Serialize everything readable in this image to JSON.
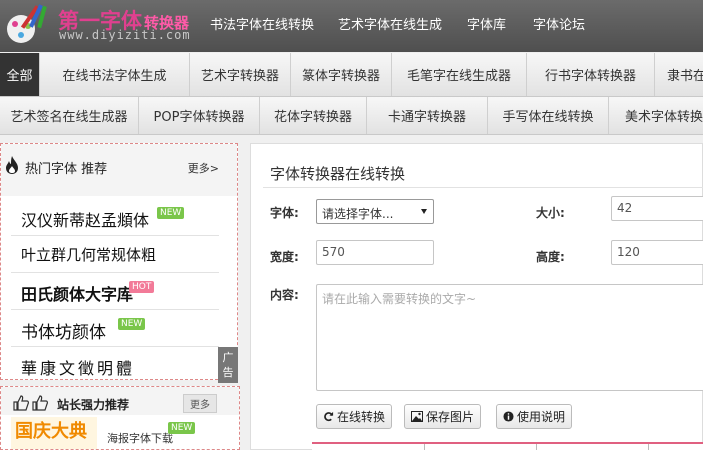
{
  "header": {
    "logo_title": "第一字体",
    "logo_sub": "转换器",
    "logo_url": "www.diyiziti.com",
    "nav": [
      "书法字体在线转换",
      "艺术字体在线生成",
      "字体库",
      "字体论坛"
    ]
  },
  "categories_row1": [
    "全部",
    "在线书法字体生成",
    "艺术字转换器",
    "篆体字转换器",
    "毛笔字在线生成器",
    "行书字体转换器",
    "隶书在"
  ],
  "categories_row2": [
    "艺术签名在线生成器",
    "POP字体转换器",
    "花体字转换器",
    "卡通字转换器",
    "手写体在线转换",
    "美术字体转换"
  ],
  "hot_fonts": {
    "title": "热门字体  推荐",
    "more": "更多>",
    "items": [
      {
        "label": "汉仪新蒂赵孟頫体",
        "badge": "NEW"
      },
      {
        "label": "叶立群几何常规体粗",
        "badge": ""
      },
      {
        "label": "田氏颜体大字库",
        "badge": "HOT"
      },
      {
        "label": "书体坊颜体",
        "badge": "NEW"
      },
      {
        "label": "華康文徵明體",
        "badge": ""
      }
    ],
    "ad_label": "广告"
  },
  "recommend": {
    "title": "站长强力推荐",
    "more": "更多",
    "thumb_text": "国庆大典",
    "link": "海报字体下载",
    "badge": "NEW"
  },
  "converter": {
    "title": "字体转换器在线转换",
    "font_label": "字体:",
    "font_select": "请选择字体...",
    "size_label": "大小:",
    "size_value": "42",
    "width_label": "宽度:",
    "width_value": "570",
    "height_label": "高度:",
    "height_value": "120",
    "content_label": "内容:",
    "content_placeholder": "请在此输入需要转换的文字~",
    "buttons": [
      "在线转换",
      "保存图片",
      "使用说明"
    ]
  }
}
